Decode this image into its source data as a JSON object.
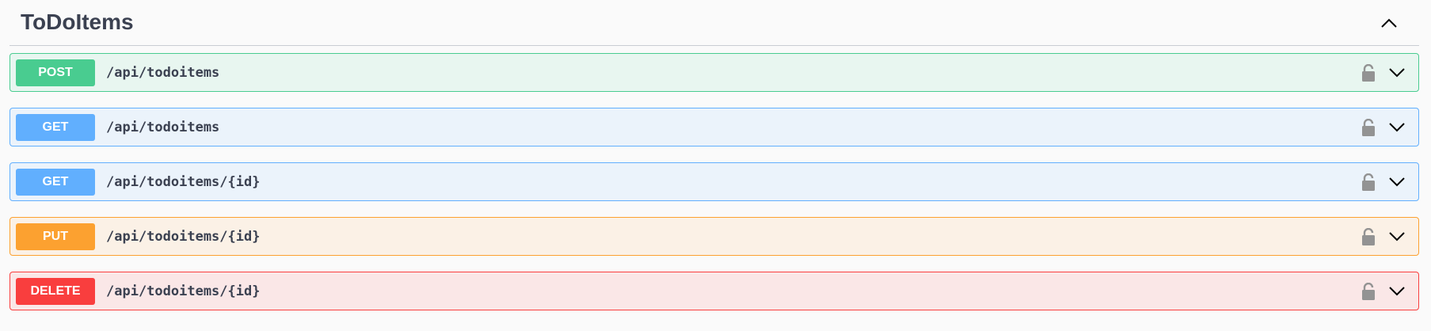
{
  "section": {
    "title": "ToDoItems",
    "collapse_icon": "chevron-up-icon"
  },
  "colors": {
    "post": "#49cc90",
    "get": "#61affe",
    "put": "#fca130",
    "delete": "#f93e3e",
    "text": "#3b4151"
  },
  "operations": [
    {
      "method": "POST",
      "path": "/api/todoitems",
      "lock_icon": "lock-icon",
      "expand_icon": "chevron-down-icon"
    },
    {
      "method": "GET",
      "path": "/api/todoitems",
      "lock_icon": "lock-icon",
      "expand_icon": "chevron-down-icon"
    },
    {
      "method": "GET",
      "path": "/api/todoitems/{id}",
      "lock_icon": "lock-icon",
      "expand_icon": "chevron-down-icon"
    },
    {
      "method": "PUT",
      "path": "/api/todoitems/{id}",
      "lock_icon": "lock-icon",
      "expand_icon": "chevron-down-icon"
    },
    {
      "method": "DELETE",
      "path": "/api/todoitems/{id}",
      "lock_icon": "lock-icon",
      "expand_icon": "chevron-down-icon"
    }
  ]
}
